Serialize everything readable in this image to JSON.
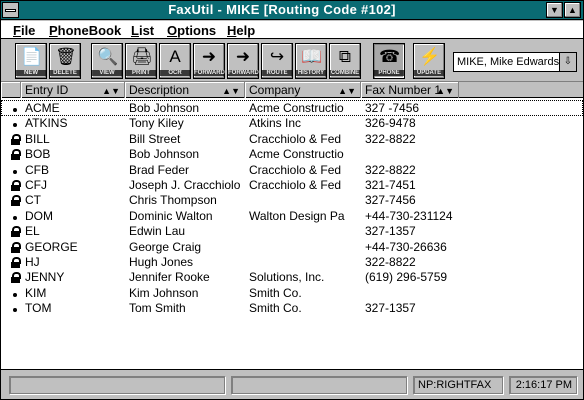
{
  "window": {
    "title": "FaxUtil - MIKE [Routing Code #102]"
  },
  "menu": [
    {
      "label_u": "F",
      "label_rest": "ile"
    },
    {
      "label_u": "P",
      "label_rest": "honeBook"
    },
    {
      "label_u": "L",
      "label_rest": "ist"
    },
    {
      "label_u": "O",
      "label_rest": "ptions"
    },
    {
      "label_u": "H",
      "label_rest": "elp"
    }
  ],
  "toolbar": {
    "buttons": [
      {
        "label": "NEW",
        "icon": "new-doc-icon"
      },
      {
        "label": "DELETE",
        "icon": "trash-icon"
      },
      {
        "label": "VIEW",
        "icon": "view-icon"
      },
      {
        "label": "PRINT",
        "icon": "print-icon"
      },
      {
        "label": "OCR",
        "icon": "ocr-icon"
      },
      {
        "label": "FORWARD",
        "icon": "forward-icon"
      },
      {
        "label": "FORWARD",
        "icon": "forward-icon"
      },
      {
        "label": "ROUTE",
        "icon": "route-icon"
      },
      {
        "label": "HISTORY",
        "icon": "history-icon"
      },
      {
        "label": "COMBINE",
        "icon": "combine-icon"
      },
      {
        "label": "PHONE",
        "icon": "phone-icon"
      },
      {
        "label": "UPDATE",
        "icon": "update-icon"
      }
    ],
    "user_select": "MIKE, Mike Edwards"
  },
  "grid": {
    "columns": [
      "Entry ID",
      "Description",
      "Company",
      "Fax Number 1"
    ],
    "rows": [
      {
        "icon": "dot",
        "id": "ACME",
        "desc": "Bob Johnson",
        "company": "Acme Constructio",
        "fax": "327 -7456",
        "selected": true
      },
      {
        "icon": "dot",
        "id": "ATKINS",
        "desc": "Tony Kiley",
        "company": "Atkins Inc",
        "fax": "326-9478"
      },
      {
        "icon": "lock",
        "id": "BILL",
        "desc": "Bill Street",
        "company": "Cracchiolo & Fed",
        "fax": "322-8822"
      },
      {
        "icon": "lock",
        "id": "BOB",
        "desc": "Bob Johnson",
        "company": "Acme Constructio",
        "fax": ""
      },
      {
        "icon": "dot",
        "id": "CFB",
        "desc": "Brad Feder",
        "company": "Cracchiolo & Fed",
        "fax": "322-8822"
      },
      {
        "icon": "lock",
        "id": "CFJ",
        "desc": "Joseph J. Cracchiolo",
        "company": "Cracchiolo & Fed",
        "fax": "321-7451"
      },
      {
        "icon": "lock",
        "id": "CT",
        "desc": "Chris Thompson",
        "company": "",
        "fax": "327-7456"
      },
      {
        "icon": "dot",
        "id": "DOM",
        "desc": "Dominic Walton",
        "company": "Walton Design Pa",
        "fax": "+44-730-231124"
      },
      {
        "icon": "lock",
        "id": "EL",
        "desc": "Edwin Lau",
        "company": "",
        "fax": "327-1357"
      },
      {
        "icon": "lock",
        "id": "GEORGE",
        "desc": "George Craig",
        "company": "",
        "fax": "+44-730-26636"
      },
      {
        "icon": "lock",
        "id": "HJ",
        "desc": "Hugh Jones",
        "company": "",
        "fax": "322-8822"
      },
      {
        "icon": "lock",
        "id": "JENNY",
        "desc": "Jennifer Rooke",
        "company": "Solutions, Inc.",
        "fax": "(619) 296-5759"
      },
      {
        "icon": "dot",
        "id": "KIM",
        "desc": "Kim Johnson",
        "company": "Smith Co.",
        "fax": ""
      },
      {
        "icon": "dot",
        "id": "TOM",
        "desc": "Tom Smith",
        "company": "Smith Co.",
        "fax": "327-1357"
      }
    ]
  },
  "status": {
    "panel1": "",
    "panel2": "",
    "server": "NP:RIGHTFAX",
    "time": "2:16:17 PM"
  },
  "colors": {
    "titlebar": "#0a6b73"
  }
}
